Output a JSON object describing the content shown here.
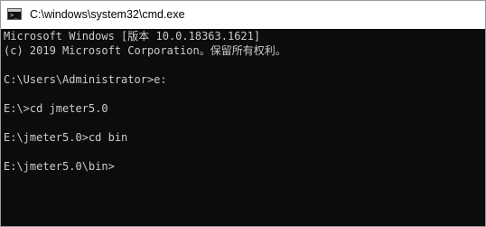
{
  "window": {
    "title": "C:\\windows\\system32\\cmd.exe",
    "icon": "cmd-console-icon",
    "icon_glyph": ">_"
  },
  "console": {
    "lines": [
      "Microsoft Windows [版本 10.0.18363.1621]",
      "(c) 2019 Microsoft Corporation。保留所有权利。",
      "",
      "C:\\Users\\Administrator>e:",
      "",
      "E:\\>cd jmeter5.0",
      "",
      "E:\\jmeter5.0>cd bin",
      "",
      "E:\\jmeter5.0\\bin>"
    ]
  },
  "colors": {
    "console_background": "#0c0c0c",
    "console_text": "#cccccc",
    "titlebar_background": "#ffffff",
    "title_text": "#000000"
  }
}
